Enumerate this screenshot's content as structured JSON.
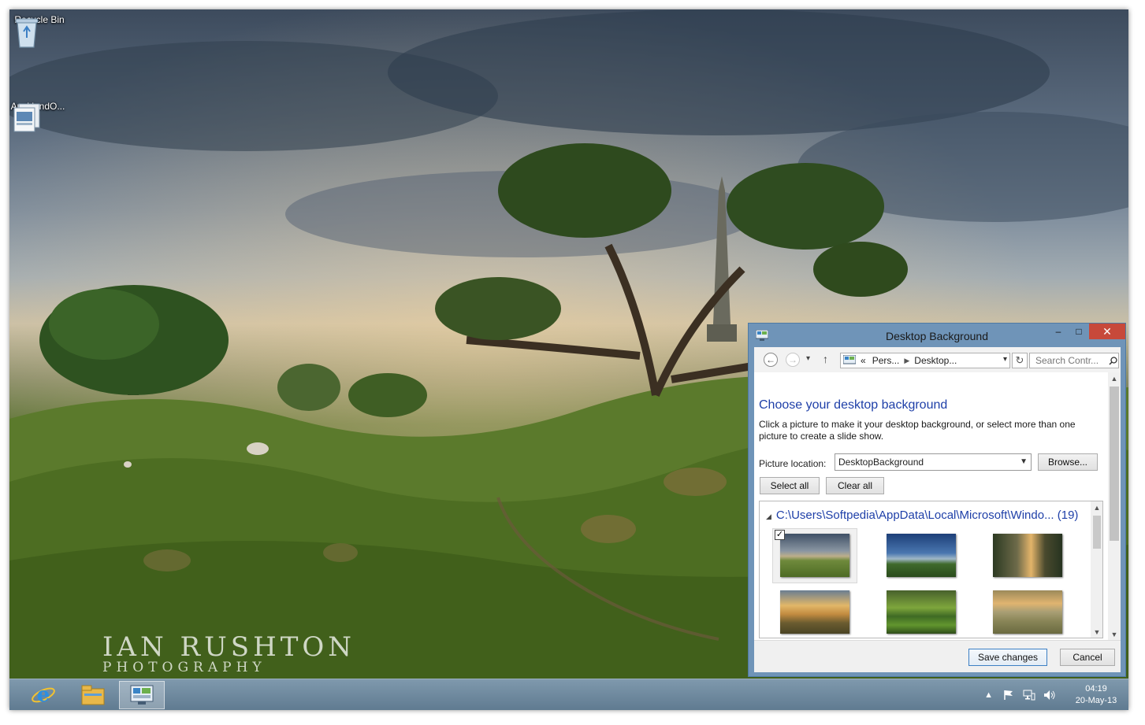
{
  "desktop": {
    "icons": [
      {
        "label": "Recycle Bin"
      },
      {
        "label": "AucklandO..."
      }
    ],
    "watermark_line1": "IAN RUSHTON",
    "watermark_line2": "PHOTOGRAPHY"
  },
  "window": {
    "title": "Desktop Background",
    "controls": {
      "minimize": "–",
      "maximize": "□",
      "close": "✕"
    },
    "nav": {
      "back": "←",
      "forward": "→",
      "recent": "▾",
      "up": "↑",
      "breadcrumb_prefix": "«",
      "breadcrumb": [
        "Pers...",
        "Desktop..."
      ],
      "refresh": "↻",
      "search_placeholder": "Search Contr..."
    },
    "heading": "Choose your desktop background",
    "description": "Click a picture to make it your desktop background, or select more than one picture to create a slide show.",
    "picture_location_label": "Picture location:",
    "picture_location_value": "DesktopBackground",
    "browse_label": "Browse...",
    "select_all_label": "Select all",
    "clear_all_label": "Clear all",
    "gallery": {
      "group_path": "C:\\Users\\Softpedia\\AppData\\Local\\Microsoft\\Windo...",
      "group_count": "(19)",
      "thumbnails": [
        {
          "name": "Thumbnail 1",
          "selected": true
        },
        {
          "name": "Thumbnail 2",
          "selected": false
        },
        {
          "name": "Thumbnail 3",
          "selected": false
        },
        {
          "name": "Thumbnail 4",
          "selected": false
        },
        {
          "name": "Thumbnail 5",
          "selected": false
        },
        {
          "name": "Thumbnail 6",
          "selected": false
        }
      ]
    },
    "save_label": "Save changes",
    "cancel_label": "Cancel"
  },
  "taskbar": {
    "apps": [
      "internet-explorer",
      "file-explorer",
      "control-panel"
    ],
    "clock_time": "04:19",
    "clock_date": "20-May-13"
  },
  "colors": {
    "accent_link": "#1e3fa8",
    "close_button": "#c7493a",
    "window_frame": "#6f94b8",
    "taskbar": "#6f8aa0"
  }
}
